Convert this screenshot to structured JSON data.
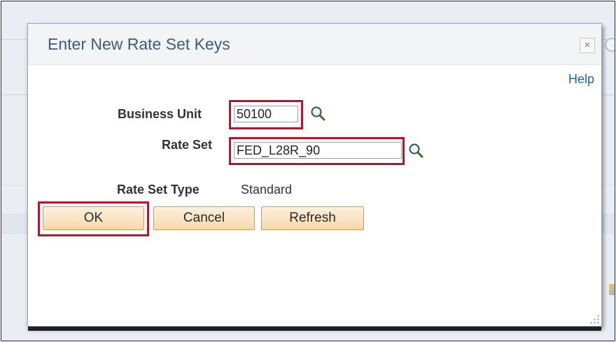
{
  "dialog": {
    "title": "Enter New Rate Set Keys",
    "close_symbol": "×",
    "help_label": "Help"
  },
  "fields": {
    "business_unit": {
      "label": "Business Unit",
      "value": "50100",
      "icon": "magnifier-icon"
    },
    "rate_set": {
      "label": "Rate Set",
      "value": "FED_L28R_90",
      "icon": "magnifier-icon"
    },
    "rate_set_type": {
      "label": "Rate Set Type",
      "value": "Standard"
    }
  },
  "buttons": {
    "ok": "OK",
    "cancel": "Cancel",
    "refresh": "Refresh"
  },
  "colors": {
    "highlight": "#b5162b",
    "title": "#3e5b7a",
    "link": "#1f5fa8",
    "button_fill": "#f6d9ac"
  }
}
